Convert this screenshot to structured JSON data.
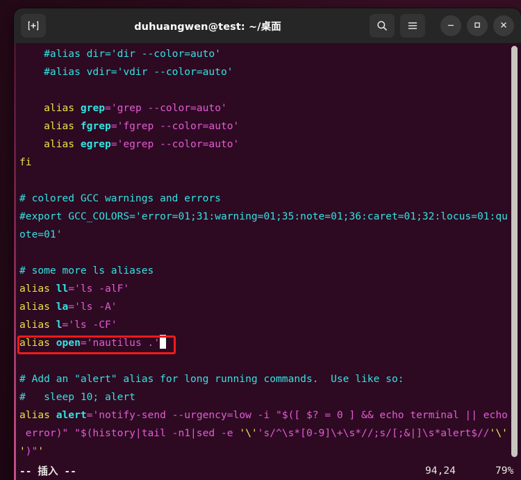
{
  "window": {
    "title": "duhuangwen@test: ~/桌面",
    "accent_red": "#f21b1b",
    "terminal_bg": "#2d0a22",
    "titlebar_bg": "#262626"
  },
  "titlebar": {
    "new_tab_label": "New Tab",
    "search_label": "Search",
    "menu_label": "Menu",
    "minimize_label": "Minimize",
    "maximize_label": "Maximize",
    "close_label": "Close"
  },
  "terminal": {
    "lines": [
      {
        "id": "l1",
        "segments": [
          {
            "t": "    #alias dir='dir --color=auto'",
            "c": "c-cyan"
          }
        ]
      },
      {
        "id": "l2",
        "segments": [
          {
            "t": "    #alias vdir='vdir --color=auto'",
            "c": "c-cyan"
          }
        ]
      },
      {
        "id": "l3",
        "segments": [
          {
            "t": "",
            "c": "c-white"
          }
        ]
      },
      {
        "id": "l4",
        "segments": [
          {
            "t": "    alias ",
            "c": "c-yellow"
          },
          {
            "t": "grep",
            "c": "c-bcyan"
          },
          {
            "t": "=",
            "c": "c-mag"
          },
          {
            "t": "'grep --color=auto'",
            "c": "c-mag"
          }
        ]
      },
      {
        "id": "l5",
        "segments": [
          {
            "t": "    alias ",
            "c": "c-yellow"
          },
          {
            "t": "fgrep",
            "c": "c-bcyan"
          },
          {
            "t": "=",
            "c": "c-mag"
          },
          {
            "t": "'fgrep --color=auto'",
            "c": "c-mag"
          }
        ]
      },
      {
        "id": "l6",
        "segments": [
          {
            "t": "    alias ",
            "c": "c-yellow"
          },
          {
            "t": "egrep",
            "c": "c-bcyan"
          },
          {
            "t": "=",
            "c": "c-mag"
          },
          {
            "t": "'egrep --color=auto'",
            "c": "c-mag"
          }
        ]
      },
      {
        "id": "l7",
        "segments": [
          {
            "t": "fi",
            "c": "c-yellow"
          }
        ]
      },
      {
        "id": "l8",
        "segments": [
          {
            "t": "",
            "c": "c-white"
          }
        ]
      },
      {
        "id": "l9",
        "segments": [
          {
            "t": "# colored GCC warnings and errors",
            "c": "c-cyan"
          }
        ]
      },
      {
        "id": "l10",
        "segments": [
          {
            "t": "#export GCC_COLORS='error=01;31:warning=01;35:note=01;36:caret=01;32:locus=01:qu",
            "c": "c-cyan"
          }
        ]
      },
      {
        "id": "l11",
        "segments": [
          {
            "t": "ote=01'",
            "c": "c-cyan"
          }
        ]
      },
      {
        "id": "l12",
        "segments": [
          {
            "t": "",
            "c": "c-white"
          }
        ]
      },
      {
        "id": "l13",
        "segments": [
          {
            "t": "# some more ls aliases",
            "c": "c-cyan"
          }
        ]
      },
      {
        "id": "l14",
        "segments": [
          {
            "t": "alias ",
            "c": "c-yellow"
          },
          {
            "t": "ll",
            "c": "c-bcyan"
          },
          {
            "t": "=",
            "c": "c-mag"
          },
          {
            "t": "'ls -alF'",
            "c": "c-mag"
          }
        ]
      },
      {
        "id": "l15",
        "segments": [
          {
            "t": "alias ",
            "c": "c-yellow"
          },
          {
            "t": "la",
            "c": "c-bcyan"
          },
          {
            "t": "=",
            "c": "c-mag"
          },
          {
            "t": "'ls -A'",
            "c": "c-mag"
          }
        ]
      },
      {
        "id": "l16",
        "segments": [
          {
            "t": "alias ",
            "c": "c-yellow"
          },
          {
            "t": "l",
            "c": "c-bcyan"
          },
          {
            "t": "=",
            "c": "c-mag"
          },
          {
            "t": "'ls -CF'",
            "c": "c-mag"
          }
        ]
      },
      {
        "id": "l17",
        "highlighted": true,
        "segments": [
          {
            "t": "alias ",
            "c": "c-yellow"
          },
          {
            "t": "open",
            "c": "c-bcyan"
          },
          {
            "t": "=",
            "c": "c-mag"
          },
          {
            "t": "'nautilus .'",
            "c": "c-mag"
          },
          {
            "t": "",
            "cursor": true
          }
        ]
      },
      {
        "id": "l18",
        "segments": [
          {
            "t": "",
            "c": "c-white"
          }
        ]
      },
      {
        "id": "l19",
        "segments": [
          {
            "t": "# Add an \"alert\" alias for long running commands.  Use like so:",
            "c": "c-cyan"
          }
        ]
      },
      {
        "id": "l20",
        "segments": [
          {
            "t": "#   sleep 10; alert",
            "c": "c-cyan"
          }
        ]
      },
      {
        "id": "l21",
        "segments": [
          {
            "t": "alias ",
            "c": "c-yellow"
          },
          {
            "t": "alert",
            "c": "c-bcyan"
          },
          {
            "t": "=",
            "c": "c-mag"
          },
          {
            "t": "'notify-send --urgency=low -i \"$([ $? = 0 ] && echo terminal || echo",
            "c": "c-mag"
          }
        ]
      },
      {
        "id": "l22",
        "segments": [
          {
            "t": " error)\" \"$(history|tail -n1|sed -e ",
            "c": "c-mag"
          },
          {
            "t": "'\\'",
            "c": "c-yelb"
          },
          {
            "t": "'s/^\\s*[0-9]\\+\\s*//;s/[;&|]\\s*alert$//",
            "c": "c-mag"
          },
          {
            "t": "'\\'",
            "c": "c-yelb"
          }
        ]
      },
      {
        "id": "l23",
        "segments": [
          {
            "t": "'",
            "c": "c-yelb"
          },
          {
            "t": ")\"",
            "c": "c-mag"
          },
          {
            "t": "'",
            "c": "c-yelb"
          }
        ]
      }
    ]
  },
  "statusline": {
    "mode": "-- 插入 --",
    "position": "94,24",
    "percent": "79%"
  }
}
